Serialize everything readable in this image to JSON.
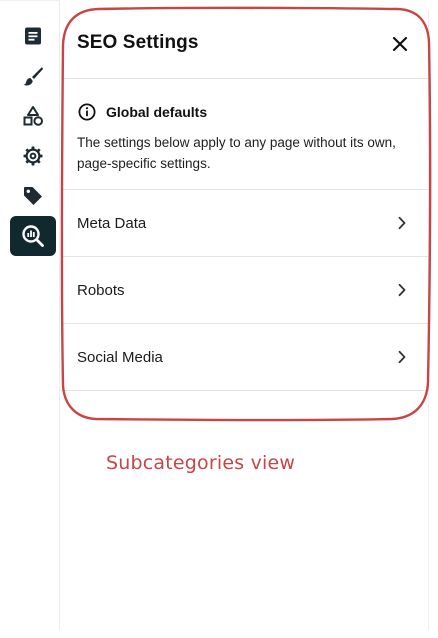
{
  "rail": {
    "items": [
      {
        "icon": "document-icon",
        "active": false
      },
      {
        "icon": "brush-icon",
        "active": false
      },
      {
        "icon": "shapes-icon",
        "active": false
      },
      {
        "icon": "gear-icon",
        "active": false
      },
      {
        "icon": "tag-icon",
        "active": false
      },
      {
        "icon": "seo-search-icon",
        "active": true
      }
    ]
  },
  "panel": {
    "title": "SEO Settings",
    "close_icon": "close-icon",
    "info": {
      "icon": "info-icon",
      "title": "Global defaults",
      "description": "The settings below apply to any page without its own, page-specific settings."
    },
    "items": [
      {
        "label": "Meta Data",
        "icon": "chevron-right-icon"
      },
      {
        "label": "Robots",
        "icon": "chevron-right-icon"
      },
      {
        "label": "Social Media",
        "icon": "chevron-right-icon"
      }
    ]
  },
  "annotation": {
    "text": "Subcategories view",
    "color": "#c94545"
  },
  "colors": {
    "active_rail_bg": "#12282f",
    "annotation": "#c94545"
  }
}
